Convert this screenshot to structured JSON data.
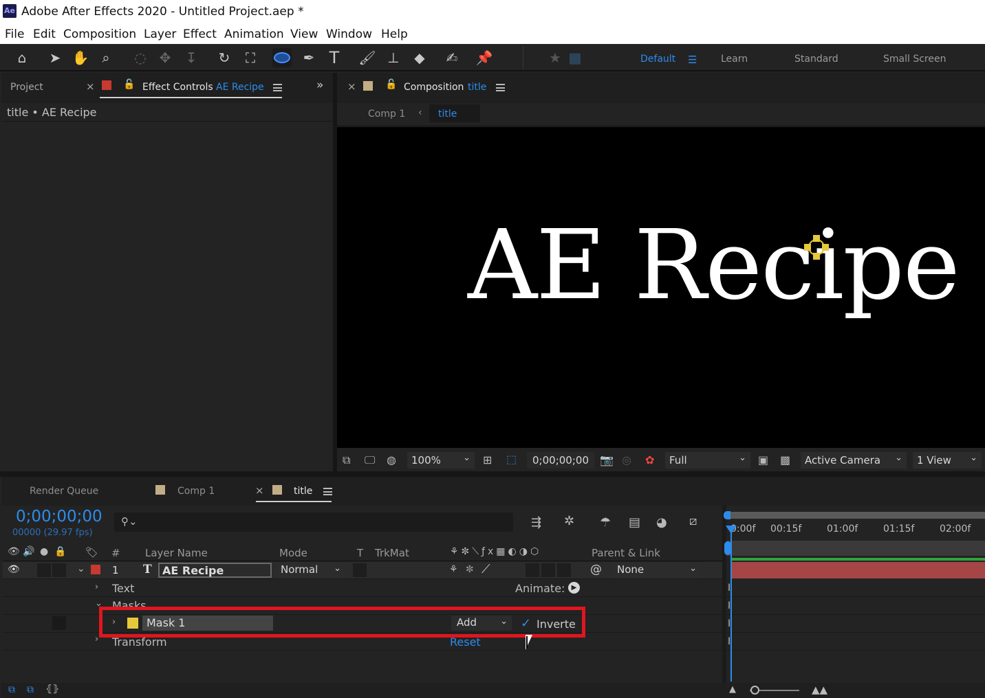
{
  "app": {
    "badge": "Ae",
    "title": "Adobe After Effects 2020 - Untitled Project.aep *"
  },
  "menu": [
    "File",
    "Edit",
    "Composition",
    "Layer",
    "Effect",
    "Animation",
    "View",
    "Window",
    "Help"
  ],
  "workspaces": {
    "default": "Default",
    "learn": "Learn",
    "standard": "Standard",
    "small": "Small Screen"
  },
  "left_panel": {
    "project_tab": "Project",
    "effect_controls_tab": "Effect Controls",
    "effect_controls_target": "AE Recipe",
    "subtitle": "title • AE Recipe"
  },
  "comp_panel": {
    "tab_label": "Composition",
    "tab_name": "title",
    "breadcrumb": [
      "Comp 1",
      "title"
    ],
    "viewer_text": "AE Recipe",
    "zoom": "100%",
    "timecode": "0;00;00;00",
    "resolution": "Full",
    "camera": "Active Camera",
    "views": "1 View"
  },
  "timeline": {
    "tabs": {
      "render_queue": "Render Queue",
      "comp1": "Comp 1",
      "title": "title"
    },
    "timecode": "0;00;00;00",
    "frames": "00000 (29.97 fps)",
    "columns": {
      "num": "#",
      "layer_name": "Layer Name",
      "mode": "Mode",
      "t": "T",
      "trkmat": "TrkMat",
      "parent": "Parent & Link"
    },
    "layer": {
      "index": "1",
      "type": "T",
      "name": "AE Recipe",
      "mode": "Normal",
      "parent": "None"
    },
    "props": {
      "text": "Text",
      "animate": "Animate:",
      "masks": "Masks",
      "transform": "Transform",
      "reset": "Reset"
    },
    "mask": {
      "name": "Mask 1",
      "mode": "Add",
      "inverted_label": "Inverte",
      "inverted": true
    },
    "ruler": [
      "0:00f",
      "00:15f",
      "01:00f",
      "01:15f",
      "02:00f"
    ]
  },
  "colors": {
    "accent": "#2d8ceb",
    "label_red": "#c8392f",
    "mask_yellow": "#e6c93a",
    "highlight": "#e0161e"
  }
}
